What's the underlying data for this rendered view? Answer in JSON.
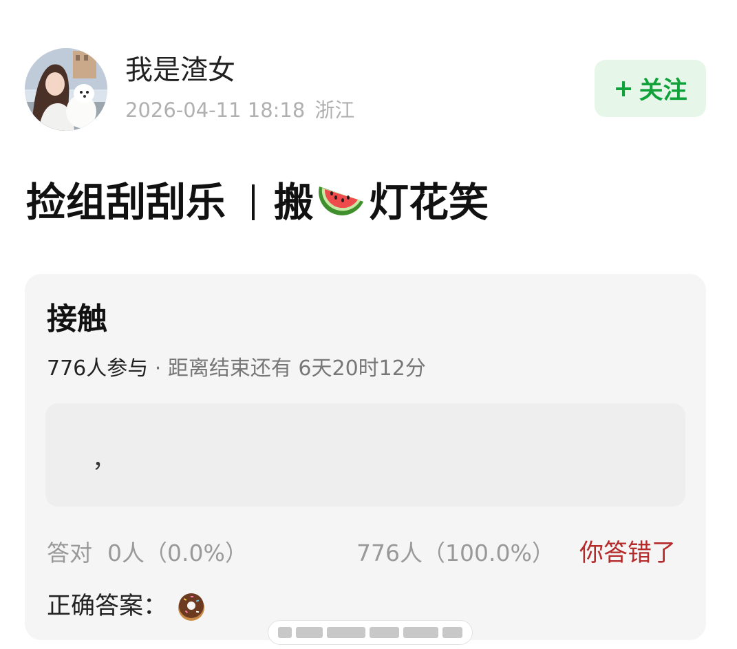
{
  "author": {
    "name": "我是渣女",
    "date": "2026-04-11 18:18",
    "location": "浙江",
    "avatar_icon": "avatar-photo"
  },
  "follow_button": {
    "plus": "+",
    "label": "关注"
  },
  "post": {
    "title_part1": "捡组刮刮乐",
    "title_part2": "搬",
    "title_icon": "watermelon-emoji",
    "title_part3": "灯花笑"
  },
  "poll": {
    "title": "接触",
    "participants": "776人参与",
    "time_left": " · 距离结束还有 6天20时12分",
    "option_text": "，",
    "correct_label": "答对",
    "correct_value": "0人（0.0%）",
    "wrong_value": "776人（100.0%）",
    "result_text": "你答错了",
    "answer_label": "正确答案：",
    "answer_icon": "donut-emoji"
  },
  "colors": {
    "follow_text": "#0fa13a",
    "follow_bg": "#e6f6e8",
    "wrong_text": "#b52a2a",
    "card_bg": "#f5f5f5"
  }
}
